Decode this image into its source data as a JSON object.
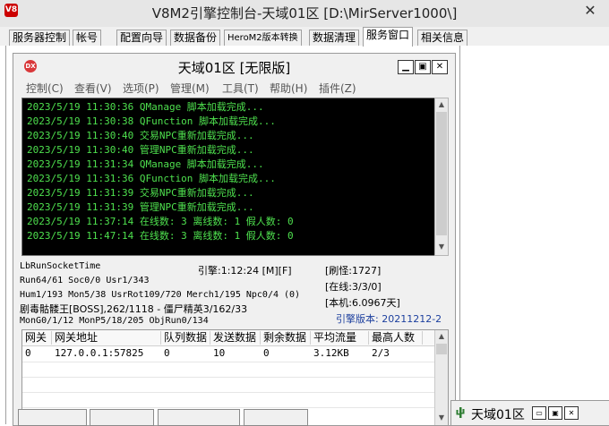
{
  "window": {
    "title": "V8M2引擎控制台-天域01区 [D:\\MirServer1000\\]",
    "close_glyph": "✕"
  },
  "tabs": [
    {
      "label": "服务器控制"
    },
    {
      "label": "帐号"
    },
    {
      "label": "配置向导"
    },
    {
      "label": "数据备份"
    },
    {
      "label": "HeroM2版本转换"
    },
    {
      "label": "数据清理"
    },
    {
      "label": "服务窗口",
      "active": true
    },
    {
      "label": "相关信息"
    }
  ],
  "inner_window": {
    "icon_text": "DX",
    "title": "天域01区 [无限版]",
    "menu": [
      {
        "label": "控制(C)"
      },
      {
        "label": "查看(V)"
      },
      {
        "label": "选项(P)"
      },
      {
        "label": "管理(M)"
      },
      {
        "label": "工具(T)"
      },
      {
        "label": "帮助(H)"
      },
      {
        "label": "插件(Z)"
      }
    ]
  },
  "log_lines": [
    "2023/5/19 11:30:36 QManage 脚本加载完成...",
    "2023/5/19 11:30:38 QFunction 脚本加载完成...",
    "2023/5/19 11:30:40 交易NPC重新加载完成...",
    "2023/5/19 11:30:40 管理NPC重新加载完成...",
    "2023/5/19 11:31:34 QManage 脚本加载完成...",
    "2023/5/19 11:31:36 QFunction 脚本加载完成...",
    "2023/5/19 11:31:39 交易NPC重新加载完成...",
    "2023/5/19 11:31:39 管理NPC重新加载完成...",
    "2023/5/19 11:37:14 在线数: 3 离线数: 1 假人数: 0",
    "2023/5/19 11:47:14 在线数: 3 离线数: 1 假人数: 0"
  ],
  "stats": {
    "socket_time": "LbRunSocketTime",
    "engine_time": "引擎:1:12:24 [M][F]",
    "monster": "[刷怪:1727]",
    "run": "Run64/61 Soc0/0 Usr1/343",
    "online": "[在线:3/3/0]",
    "hum": "Hum1/193 Mon5/38 UsrRot109/720 Merch1/195 Npc0/4 (0)",
    "uptime": "[本机:6.0967天]",
    "boss": "剧毒骷髅王[BOSS],262/1118 - 僵尸精英3/162/33",
    "engine_version": "引擎版本: 20211212-2",
    "mon": "MonG0/1/12 MonP5/18/205 ObjRun0/134"
  },
  "gateway_table": {
    "columns": [
      "网关",
      "网关地址",
      "队列数据",
      "发送数据",
      "剩余数据",
      "平均流量",
      "最高人数"
    ],
    "rows": [
      [
        "0",
        "127.0.0.1:57825",
        "0",
        "10",
        "0",
        "3.12KB",
        "2/3"
      ]
    ]
  },
  "minimized_window": {
    "title": "天域01区"
  },
  "colors": {
    "console_bg": "#000000",
    "console_text": "#4ee04e",
    "version_text": "#1c3f9e"
  }
}
